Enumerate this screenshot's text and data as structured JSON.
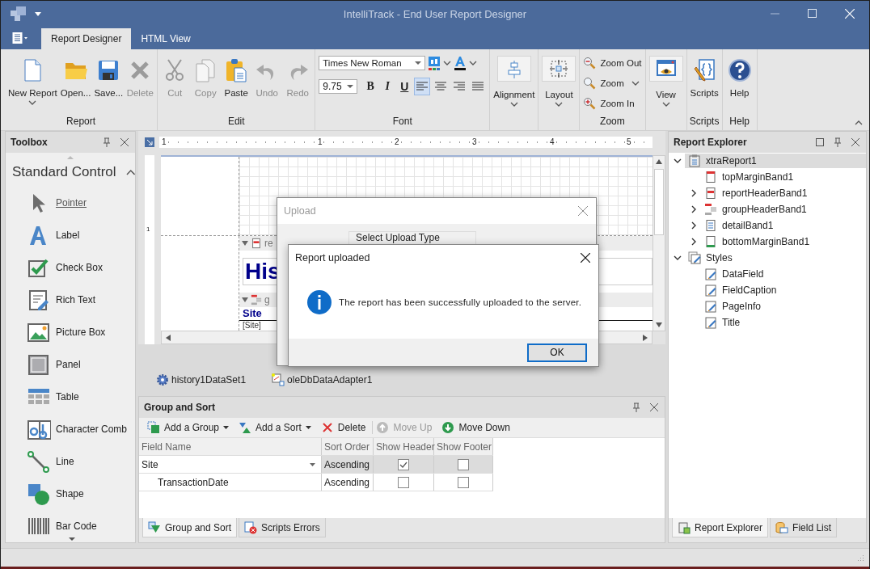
{
  "window": {
    "title": "IntelliTrack - End User Report Designer"
  },
  "ribbon_tabs": [
    {
      "label": "Report Designer",
      "selected": true
    },
    {
      "label": "HTML View",
      "selected": false
    }
  ],
  "ribbon_groups": [
    {
      "kind": "buttons",
      "label": "Report",
      "buttons": [
        {
          "label": "New Report",
          "dropdown": true,
          "disabled": false
        },
        {
          "label": "Open...",
          "dropdown": false,
          "disabled": false
        },
        {
          "label": "Save...",
          "dropdown": false,
          "disabled": false
        },
        {
          "label": "Delete",
          "dropdown": false,
          "disabled": true
        }
      ]
    },
    {
      "kind": "buttons",
      "label": "Edit",
      "buttons": [
        {
          "label": "Cut",
          "dropdown": false,
          "disabled": true
        },
        {
          "label": "Copy",
          "dropdown": false,
          "disabled": true
        },
        {
          "label": "Paste",
          "dropdown": false,
          "disabled": false
        },
        {
          "label": "Undo",
          "dropdown": false,
          "disabled": true
        },
        {
          "label": "Redo",
          "dropdown": false,
          "disabled": true
        }
      ]
    },
    {
      "kind": "font",
      "label": "Font",
      "font_name": "Times New Roman",
      "font_size": "9.75",
      "styles": [
        {
          "label": "B"
        },
        {
          "label": "I"
        },
        {
          "label": "U"
        }
      ],
      "alignments": [
        {
          "selected": true
        },
        {
          "selected": false
        },
        {
          "selected": false
        },
        {
          "selected": false
        }
      ]
    },
    {
      "kind": "buttons",
      "buttons": [
        {
          "label": "Alignment",
          "dropdown": true,
          "disabled": false
        }
      ]
    },
    {
      "kind": "buttons",
      "buttons": [
        {
          "label": "Layout",
          "dropdown": true,
          "disabled": false
        }
      ]
    },
    {
      "kind": "zoom",
      "label": "Zoom",
      "buttons": [
        {
          "label": "Zoom Out",
          "dropdown": false
        },
        {
          "label": "Zoom",
          "dropdown": true
        },
        {
          "label": "Zoom In",
          "dropdown": false
        }
      ]
    },
    {
      "kind": "buttons",
      "buttons": [
        {
          "label": "View",
          "dropdown": true,
          "disabled": false
        }
      ]
    },
    {
      "kind": "buttons",
      "label": "Scripts",
      "buttons": [
        {
          "label": "Scripts",
          "dropdown": false,
          "disabled": false
        }
      ]
    },
    {
      "kind": "buttons",
      "label": "Help",
      "buttons": [
        {
          "label": "Help",
          "dropdown": false,
          "disabled": false
        }
      ]
    }
  ],
  "toolbox": {
    "title": "Toolbox",
    "section": "Standard Control",
    "items": [
      {
        "label": "Pointer",
        "selected": true
      },
      {
        "label": "Label",
        "selected": false
      },
      {
        "label": "Check Box",
        "selected": false
      },
      {
        "label": "Rich Text",
        "selected": false
      },
      {
        "label": "Picture Box",
        "selected": false
      },
      {
        "label": "Panel",
        "selected": false
      },
      {
        "label": "Table",
        "selected": false
      },
      {
        "label": "Character Comb",
        "selected": false
      },
      {
        "label": "Line",
        "selected": false
      },
      {
        "label": "Shape",
        "selected": false
      },
      {
        "label": "Bar Code",
        "selected": false
      }
    ]
  },
  "design": {
    "ruler_labels": [
      "1",
      "1",
      "2",
      "3",
      "4",
      "5"
    ],
    "vertical_ruler_labels": [
      "1"
    ],
    "report_header": {
      "label": "re",
      "title": "His"
    },
    "group_header": {
      "label": "g",
      "caption": "Site",
      "field": "[Site]"
    }
  },
  "tray": [
    {
      "label": "history1DataSet1"
    },
    {
      "label": "oleDbDataAdapter1"
    }
  ],
  "group_sort": {
    "title": "Group and Sort",
    "toolbar": [
      {
        "label": "Add a Group",
        "dropdown": true,
        "disabled": false
      },
      {
        "label": "Add a Sort",
        "dropdown": true,
        "disabled": false
      },
      {
        "label": "Delete",
        "dropdown": false,
        "disabled": false
      },
      {
        "label": "Move Up",
        "dropdown": false,
        "disabled": true
      },
      {
        "label": "Move Down",
        "dropdown": false,
        "disabled": false
      }
    ],
    "columns": [
      "Field Name",
      "Sort Order",
      "Show Header",
      "Show Footer"
    ],
    "rows": [
      {
        "field": "Site",
        "sort_order": "Ascending",
        "show_header": true,
        "show_footer": false,
        "selected": true,
        "children": [
          {
            "field": "TransactionDate",
            "sort_order": "Ascending",
            "show_header": false,
            "show_footer": false,
            "selected": false
          }
        ]
      }
    ],
    "tabs": [
      {
        "label": "Group and Sort",
        "selected": true
      },
      {
        "label": "Scripts Errors",
        "selected": false
      }
    ]
  },
  "explorer": {
    "title": "Report Explorer",
    "tree": [
      {
        "label": "xtraReport1",
        "expanded": true,
        "selected": true,
        "children": [
          {
            "label": "topMarginBand1",
            "selected": false
          },
          {
            "label": "reportHeaderBand1",
            "expanded": false,
            "selected": false
          },
          {
            "label": "groupHeaderBand1",
            "expanded": false,
            "selected": false
          },
          {
            "label": "detailBand1",
            "expanded": false,
            "selected": false
          },
          {
            "label": "bottomMarginBand1",
            "expanded": false,
            "selected": false
          }
        ]
      },
      {
        "label": "Styles",
        "expanded": true,
        "selected": false,
        "children": [
          {
            "label": "DataField",
            "selected": false
          },
          {
            "label": "FieldCaption",
            "selected": false
          },
          {
            "label": "PageInfo",
            "selected": false
          },
          {
            "label": "Title",
            "selected": false
          }
        ]
      }
    ],
    "tabs": [
      {
        "label": "Report Explorer",
        "selected": true
      },
      {
        "label": "Field List",
        "selected": false
      }
    ]
  },
  "upload_dialog": {
    "title": "Upload",
    "group_label": "Select Upload Type"
  },
  "message_dialog": {
    "title": "Report uploaded",
    "message": "The report has been successfully uploaded to the server.",
    "button": "OK"
  }
}
